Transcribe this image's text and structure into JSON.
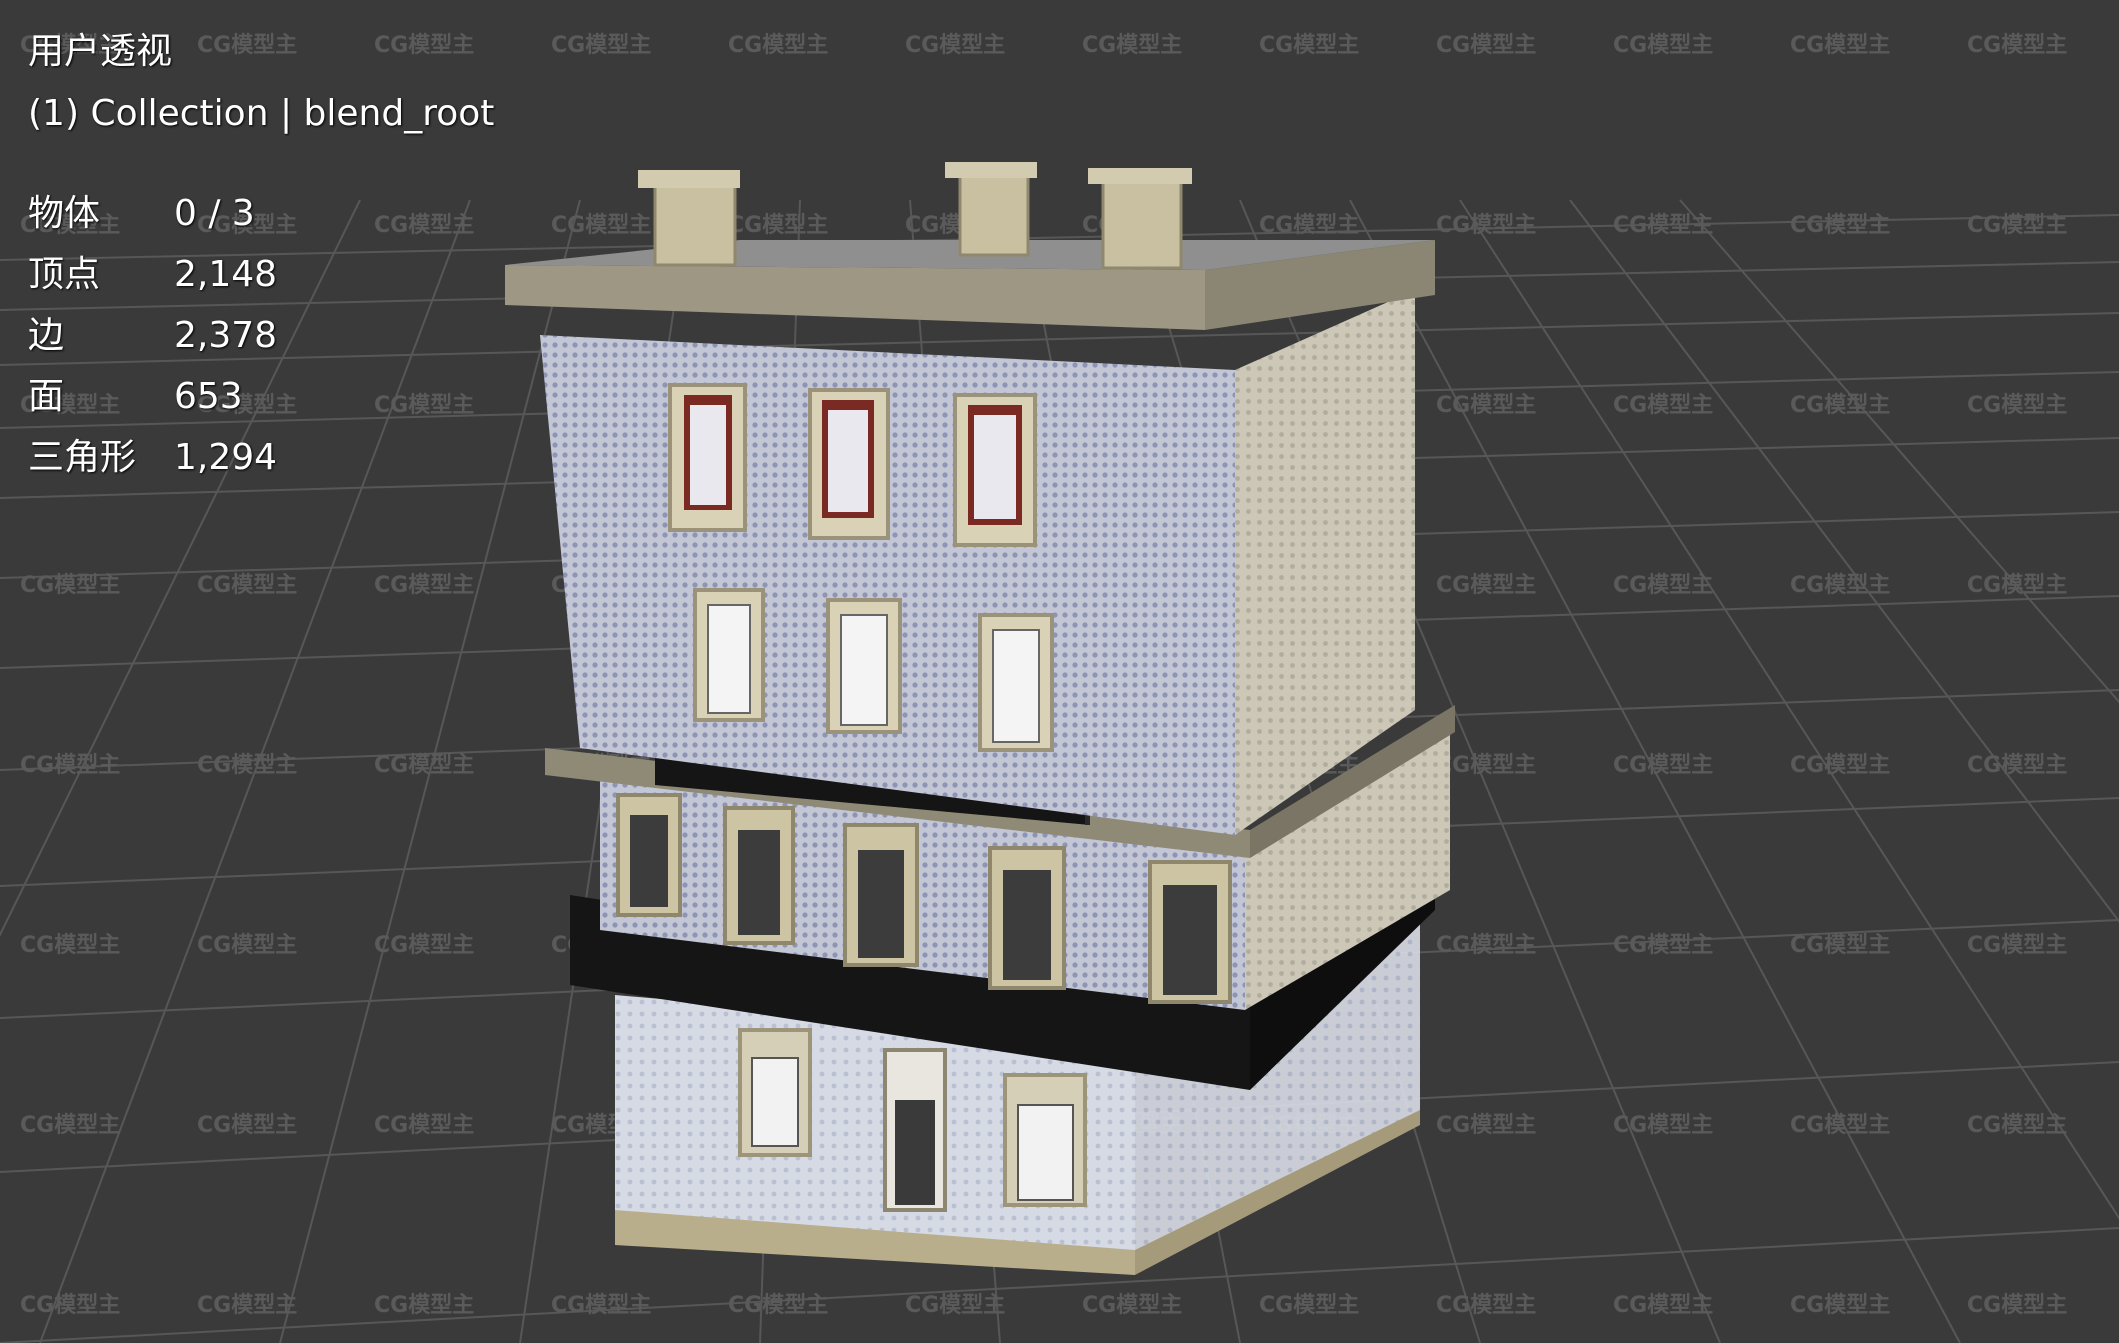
{
  "viewport": {
    "view_name": "用户透视",
    "collection_label": "(1) Collection | blend_root",
    "watermark": "CG模型主",
    "background_color": "#3a3a3a",
    "grid_color": "#555555"
  },
  "stats": [
    {
      "label": "物体",
      "value": "0 / 3"
    },
    {
      "label": "顶点",
      "value": "2,148"
    },
    {
      "label": "边",
      "value": "2,378"
    },
    {
      "label": "面",
      "value": "653"
    },
    {
      "label": "三角形",
      "value": "1,294"
    }
  ],
  "model": {
    "name": "blend_root",
    "facade_color": "#bfc2d0",
    "side_color": "#c9c3b3",
    "stone_trim_color": "#a8a28c",
    "balcony_color": "#121212"
  }
}
